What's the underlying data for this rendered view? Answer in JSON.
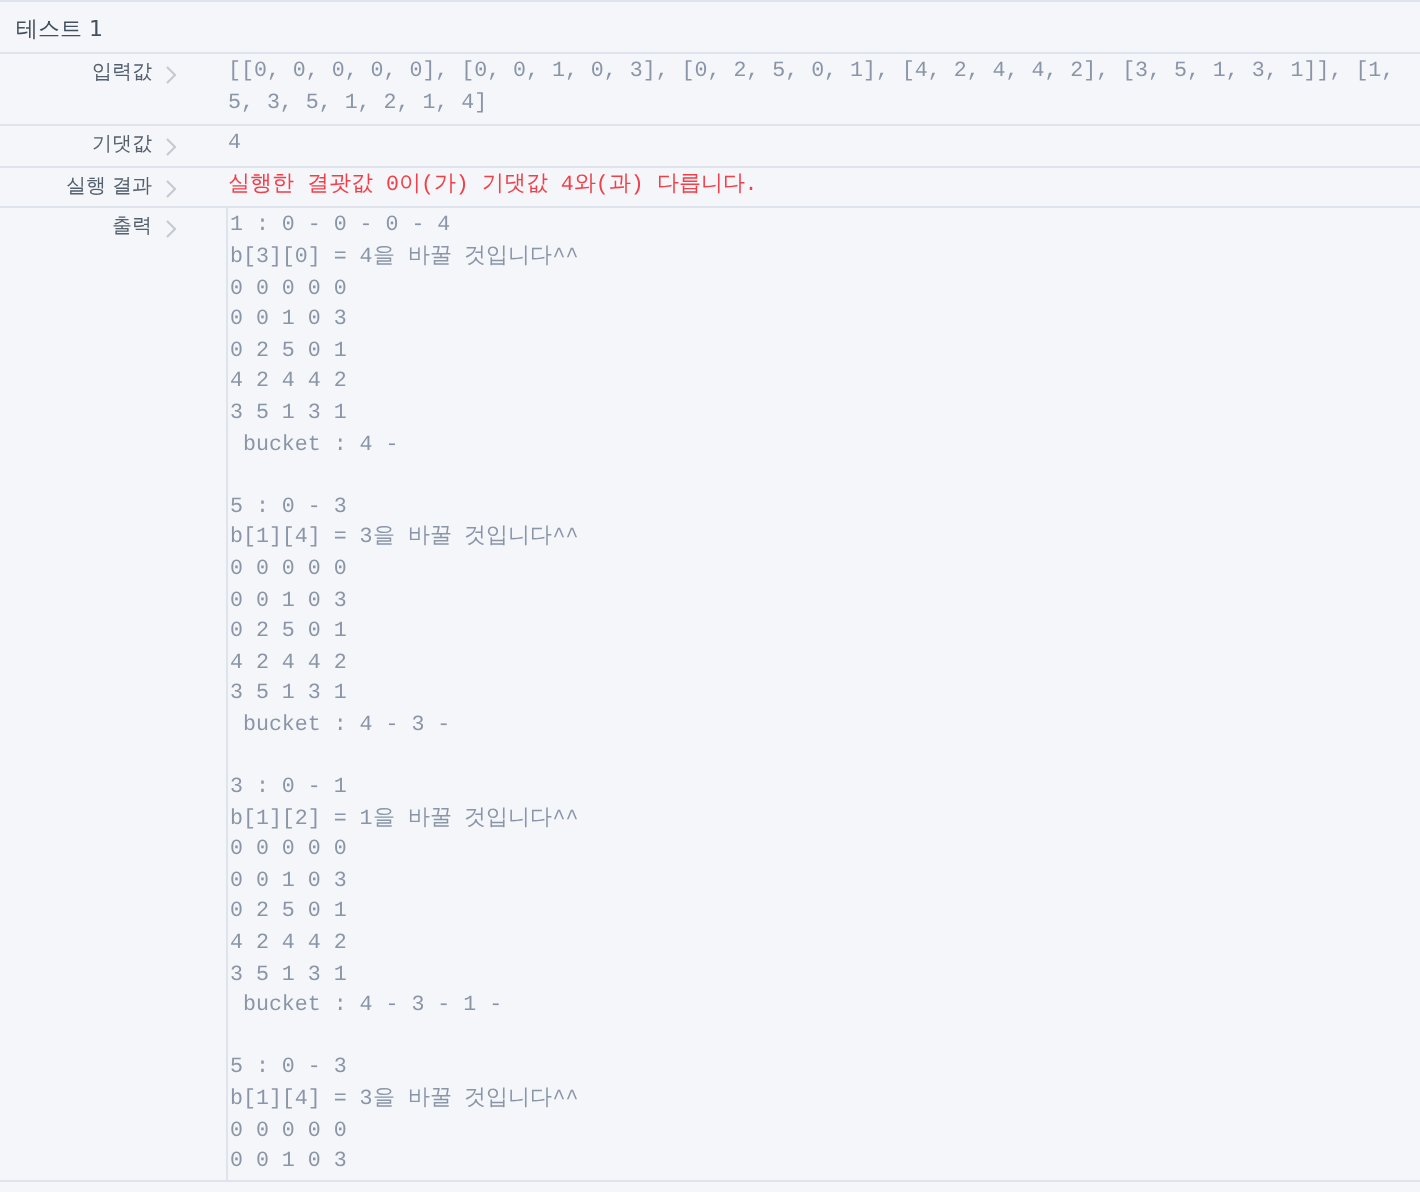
{
  "title": "테스트 1",
  "rows": [
    {
      "label": "입력값",
      "kind": "plain",
      "value": "[[0, 0, 0, 0, 0], [0, 0, 1, 0, 3], [0, 2, 5, 0, 1], [4, 2, 4, 4, 2], [3, 5, 1, 3, 1]], [1, 5, 3, 5, 1, 2, 1, 4]"
    },
    {
      "label": "기댓값",
      "kind": "plain",
      "value": "4"
    },
    {
      "label": "실행 결과",
      "kind": "error",
      "value": "실행한 결괏값 0이(가) 기댓값 4와(과) 다릅니다."
    },
    {
      "label": "출력",
      "kind": "output",
      "blocks": [
        [
          "1 : 0 - 0 - 0 - 4",
          "b[3][0] = 4을 바꿀 것입니다^^",
          "0 0 0 0 0",
          "0 0 1 0 3",
          "0 2 5 0 1",
          "4 2 4 4 2",
          "3 5 1 3 1",
          " bucket : 4 -"
        ],
        [
          "5 : 0 - 3",
          "b[1][4] = 3을 바꿀 것입니다^^",
          "0 0 0 0 0",
          "0 0 1 0 3",
          "0 2 5 0 1",
          "4 2 4 4 2",
          "3 5 1 3 1",
          " bucket : 4 - 3 -"
        ],
        [
          "3 : 0 - 1",
          "b[1][2] = 1을 바꿀 것입니다^^",
          "0 0 0 0 0",
          "0 0 1 0 3",
          "0 2 5 0 1",
          "4 2 4 4 2",
          "3 5 1 3 1",
          " bucket : 4 - 3 - 1 -"
        ],
        [
          "5 : 0 - 3",
          "b[1][4] = 3을 바꿀 것입니다^^",
          "0 0 0 0 0",
          "0 0 1 0 3"
        ]
      ]
    }
  ]
}
